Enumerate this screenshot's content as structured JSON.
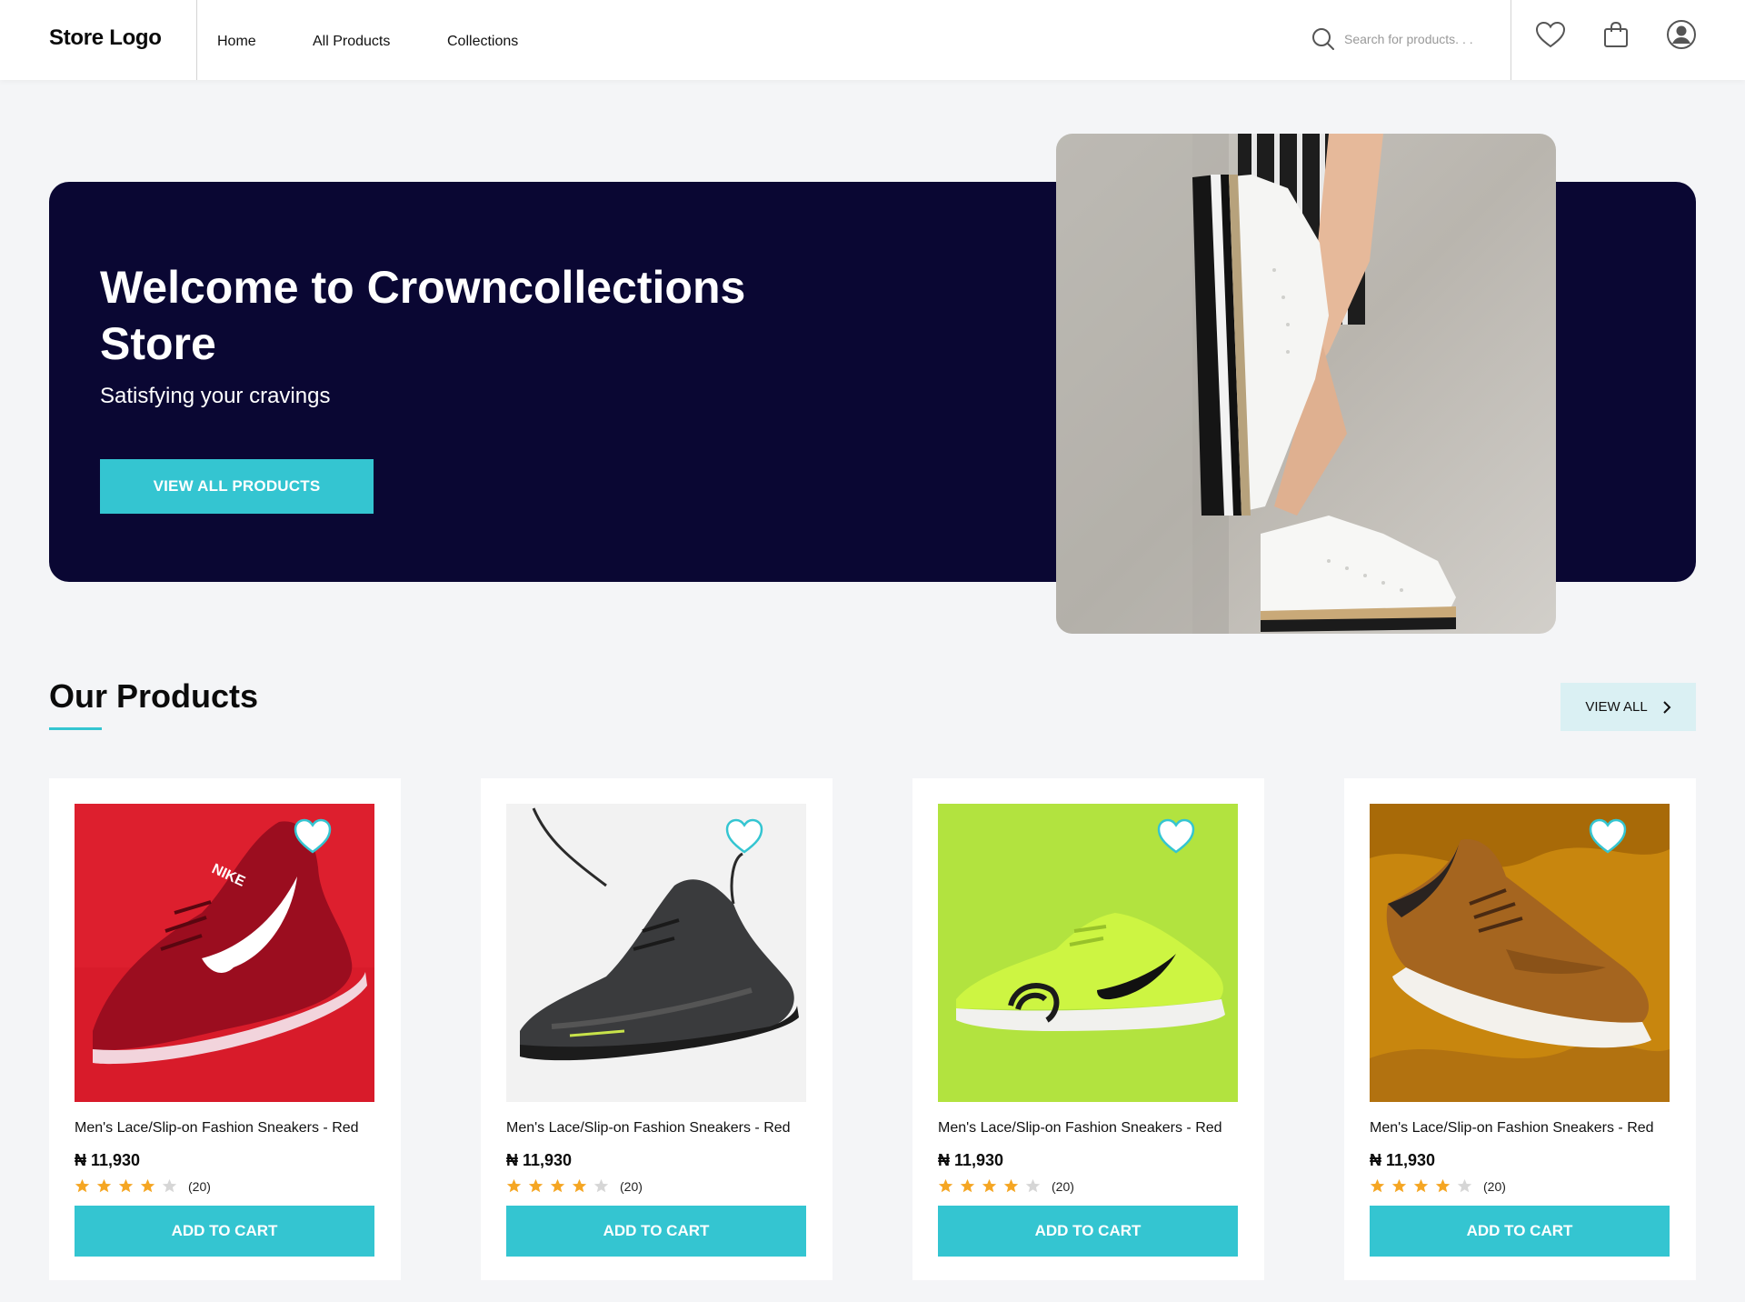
{
  "header": {
    "logo": "Store Logo",
    "nav": [
      "Home",
      "All Products",
      "Collections"
    ],
    "search_placeholder": "Search for products. . ."
  },
  "hero": {
    "title": "Welcome to Crowncollections Store",
    "subtitle": "Satisfying your cravings",
    "button_label": "VIEW ALL PRODUCTS"
  },
  "products_section": {
    "title": "Our Products",
    "view_all_label": "VIEW ALL"
  },
  "products": [
    {
      "name": "Men's Lace/Slip-on Fashion Sneakers - Red",
      "price": "₦ 11,930",
      "rating": 4,
      "reviews": "(20)",
      "cart_label": "ADD TO CART",
      "image": "red-nike-sneaker"
    },
    {
      "name": "Men's Lace/Slip-on Fashion Sneakers - Red",
      "price": "₦ 11,930",
      "rating": 4,
      "reviews": "(20)",
      "cart_label": "ADD TO CART",
      "image": "black-running-sneaker"
    },
    {
      "name": "Men's Lace/Slip-on Fashion Sneakers - Red",
      "price": "₦ 11,930",
      "rating": 4,
      "reviews": "(20)",
      "cart_label": "ADD TO CART",
      "image": "green-nike-sneaker"
    },
    {
      "name": "Men's Lace/Slip-on Fashion Sneakers - Red",
      "price": "₦ 11,930",
      "rating": 4,
      "reviews": "(20)",
      "cart_label": "ADD TO CART",
      "image": "brown-nike-sneaker"
    }
  ],
  "colors": {
    "accent": "#34c5d1",
    "hero_bg": "#0a0733",
    "star_on": "#f5a623",
    "star_off": "#d6d6d6"
  },
  "icons": [
    "search-icon",
    "heart-icon",
    "shopping-bag-icon",
    "user-icon",
    "chevron-right-icon",
    "star-icon"
  ]
}
